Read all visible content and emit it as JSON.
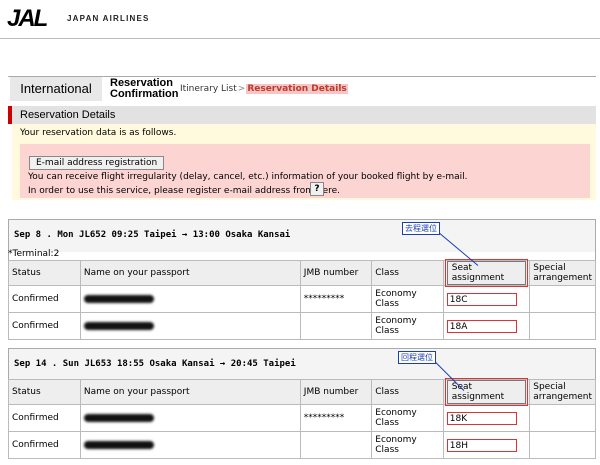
{
  "header": {
    "logo": "JAL",
    "brand": "JAPAN AIRLINES"
  },
  "tabs": {
    "international": "International",
    "reservation_line1": "Reservation",
    "reservation_line2": "Confirmation"
  },
  "breadcrumb": {
    "itinerary": "Itinerary List",
    "separator": ">",
    "current": "Reservation Details"
  },
  "details": {
    "title": "Reservation Details",
    "intro": "Your reservation data is as follows.",
    "email_button": "E-mail address registration",
    "line1": "You can receive flight irregularity (delay, cancel, etc.) information of your booked flight by e-mail.",
    "line2": "In order to use this service, please register e-mail address from here.",
    "help_button": "?"
  },
  "columns": {
    "status": "Status",
    "name": "Name on your passport",
    "jmb": "JMB number",
    "class": "Class",
    "seat": "Seat assignment",
    "special": "Special arrangement"
  },
  "flights": [
    {
      "header": "Sep 8 . Mon  JL652  09:25  Taipei  →  13:00 Osaka Kansai",
      "terminal": "*Terminal:2",
      "callout": "去程選位",
      "rows": [
        {
          "status": "Confirmed",
          "jmb": "*********",
          "class": "Economy Class",
          "seat": "18C"
        },
        {
          "status": "Confirmed",
          "jmb": "",
          "class": "Economy Class",
          "seat": "18A"
        }
      ]
    },
    {
      "header": "Sep 14 . Sun  JL653  18:55  Osaka Kansai  →  20:45 Taipei",
      "callout": "回程選位",
      "rows": [
        {
          "status": "Confirmed",
          "jmb": "*********",
          "class": "Economy Class",
          "seat": "18K"
        },
        {
          "status": "Confirmed",
          "jmb": "",
          "class": "Economy Class",
          "seat": "18H"
        }
      ]
    }
  ]
}
